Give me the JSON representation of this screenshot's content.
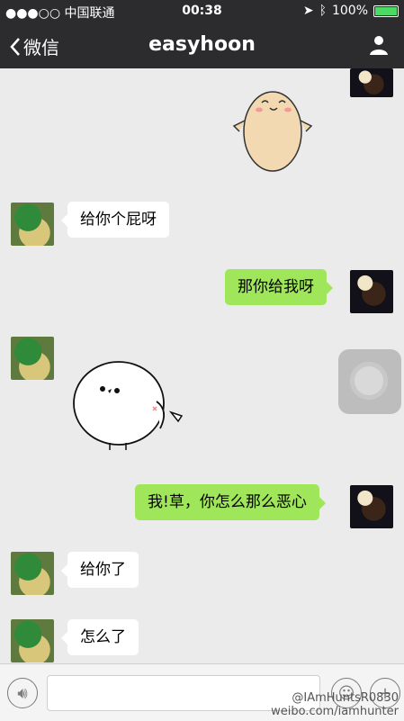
{
  "status_bar": {
    "carrier": "●●●○○ 中国联通",
    "time": "00:38",
    "battery": "100%"
  },
  "nav": {
    "back_label": "微信",
    "title": "easyhoon"
  },
  "messages": [
    {
      "side": "right",
      "type": "sticker",
      "sticker": "potato-sticker"
    },
    {
      "side": "left",
      "type": "text",
      "text": "给你个屁呀"
    },
    {
      "side": "right",
      "type": "text",
      "text": "那你给我呀"
    },
    {
      "side": "left",
      "type": "sticker",
      "sticker": "white-bird-sticker"
    },
    {
      "side": "right",
      "type": "text",
      "text": "我!草，你怎么那么恶心"
    },
    {
      "side": "left",
      "type": "text",
      "text": "给你了"
    },
    {
      "side": "left",
      "type": "text",
      "text": "怎么了"
    }
  ],
  "watermark": {
    "line1": "@IAmHuntsR0830",
    "line2": "weibo.com/iamhunter"
  },
  "icons": {
    "back": "chevron-left-icon",
    "profile": "person-icon",
    "voice": "voice-icon",
    "emoji": "emoji-icon",
    "add": "plus-icon"
  },
  "colors": {
    "nav_bg": "#2c2c2e",
    "chat_bg": "#ebebeb",
    "my_bubble": "#9fe65b",
    "their_bubble": "#ffffff"
  }
}
